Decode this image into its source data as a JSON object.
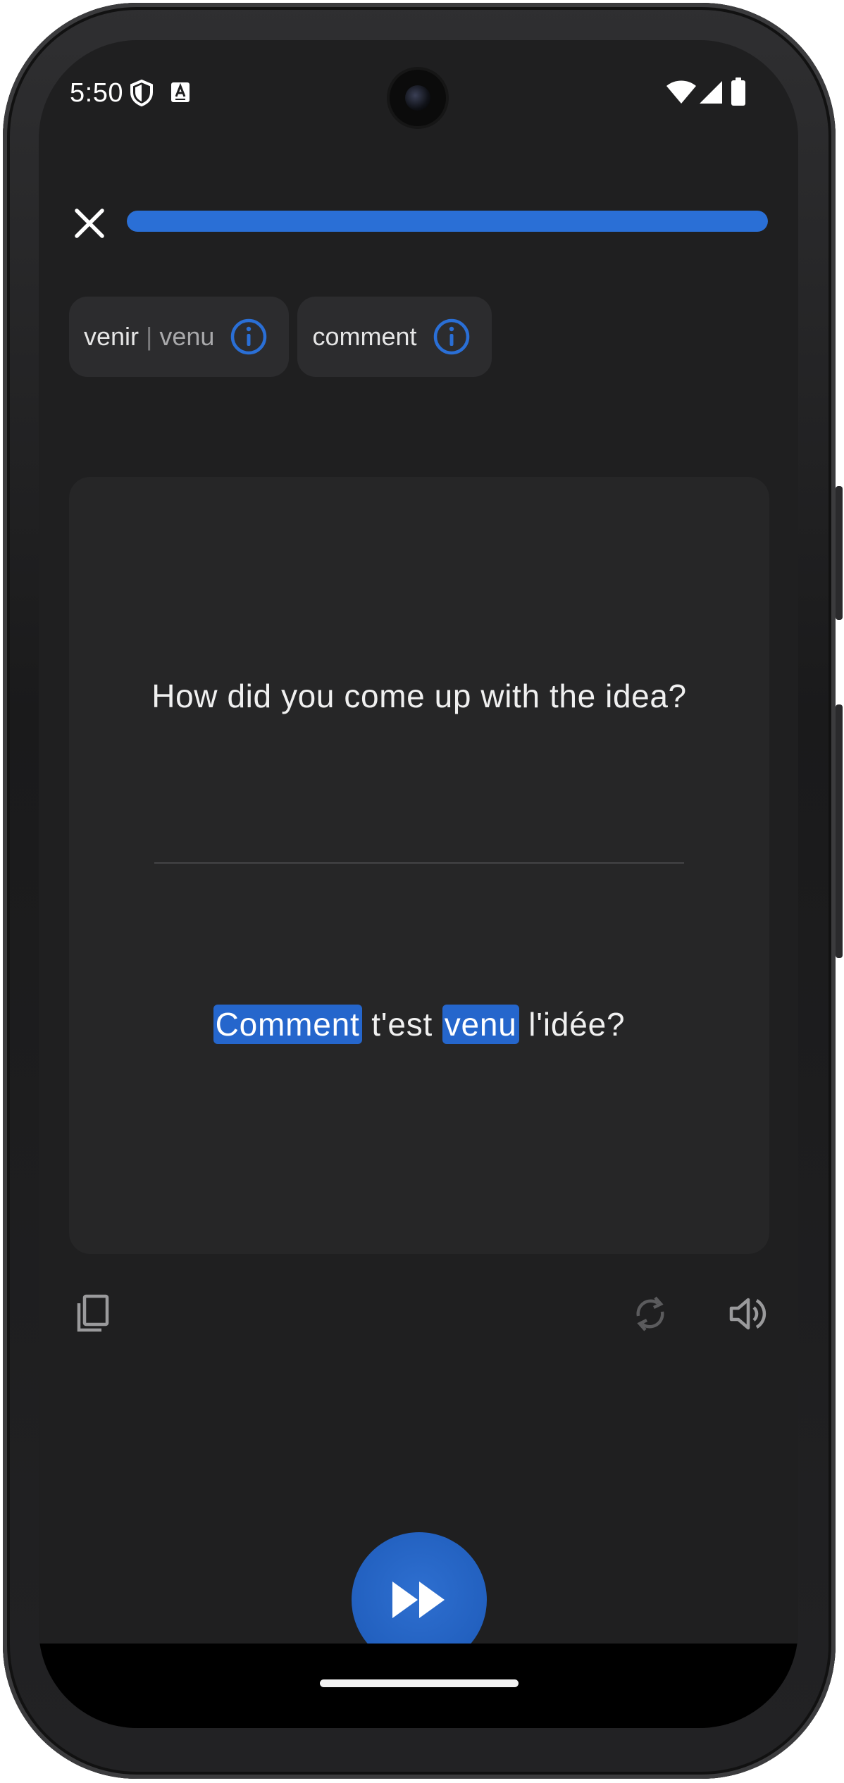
{
  "status_bar": {
    "time": "5:50",
    "icons": [
      "shield-icon",
      "font-badge-icon",
      "wifi-icon",
      "cell-signal-icon",
      "battery-icon"
    ]
  },
  "header": {
    "close_icon": "close-icon",
    "progress_percent": 100
  },
  "chips": [
    {
      "lemma": "venir",
      "separator": "|",
      "form": "venu",
      "icon": "info-icon"
    },
    {
      "lemma": "comment",
      "icon": "info-icon"
    }
  ],
  "card": {
    "prompt": "How did you come up with the idea?",
    "translation": {
      "word1": "Comment",
      "text1": " t'est ",
      "word2": "venu",
      "text2": " l'idée?"
    }
  },
  "actions": {
    "copy_icon": "copy-icon",
    "repeat_icon": "repeat-icon",
    "speaker_icon": "speaker-icon"
  },
  "fab": {
    "icon": "fast-forward-icon"
  },
  "colors": {
    "accent": "#2a6fd6",
    "highlight": "#2566cc",
    "background": "#1f1f20",
    "card": "#262627",
    "chip": "#2c2c2e"
  }
}
